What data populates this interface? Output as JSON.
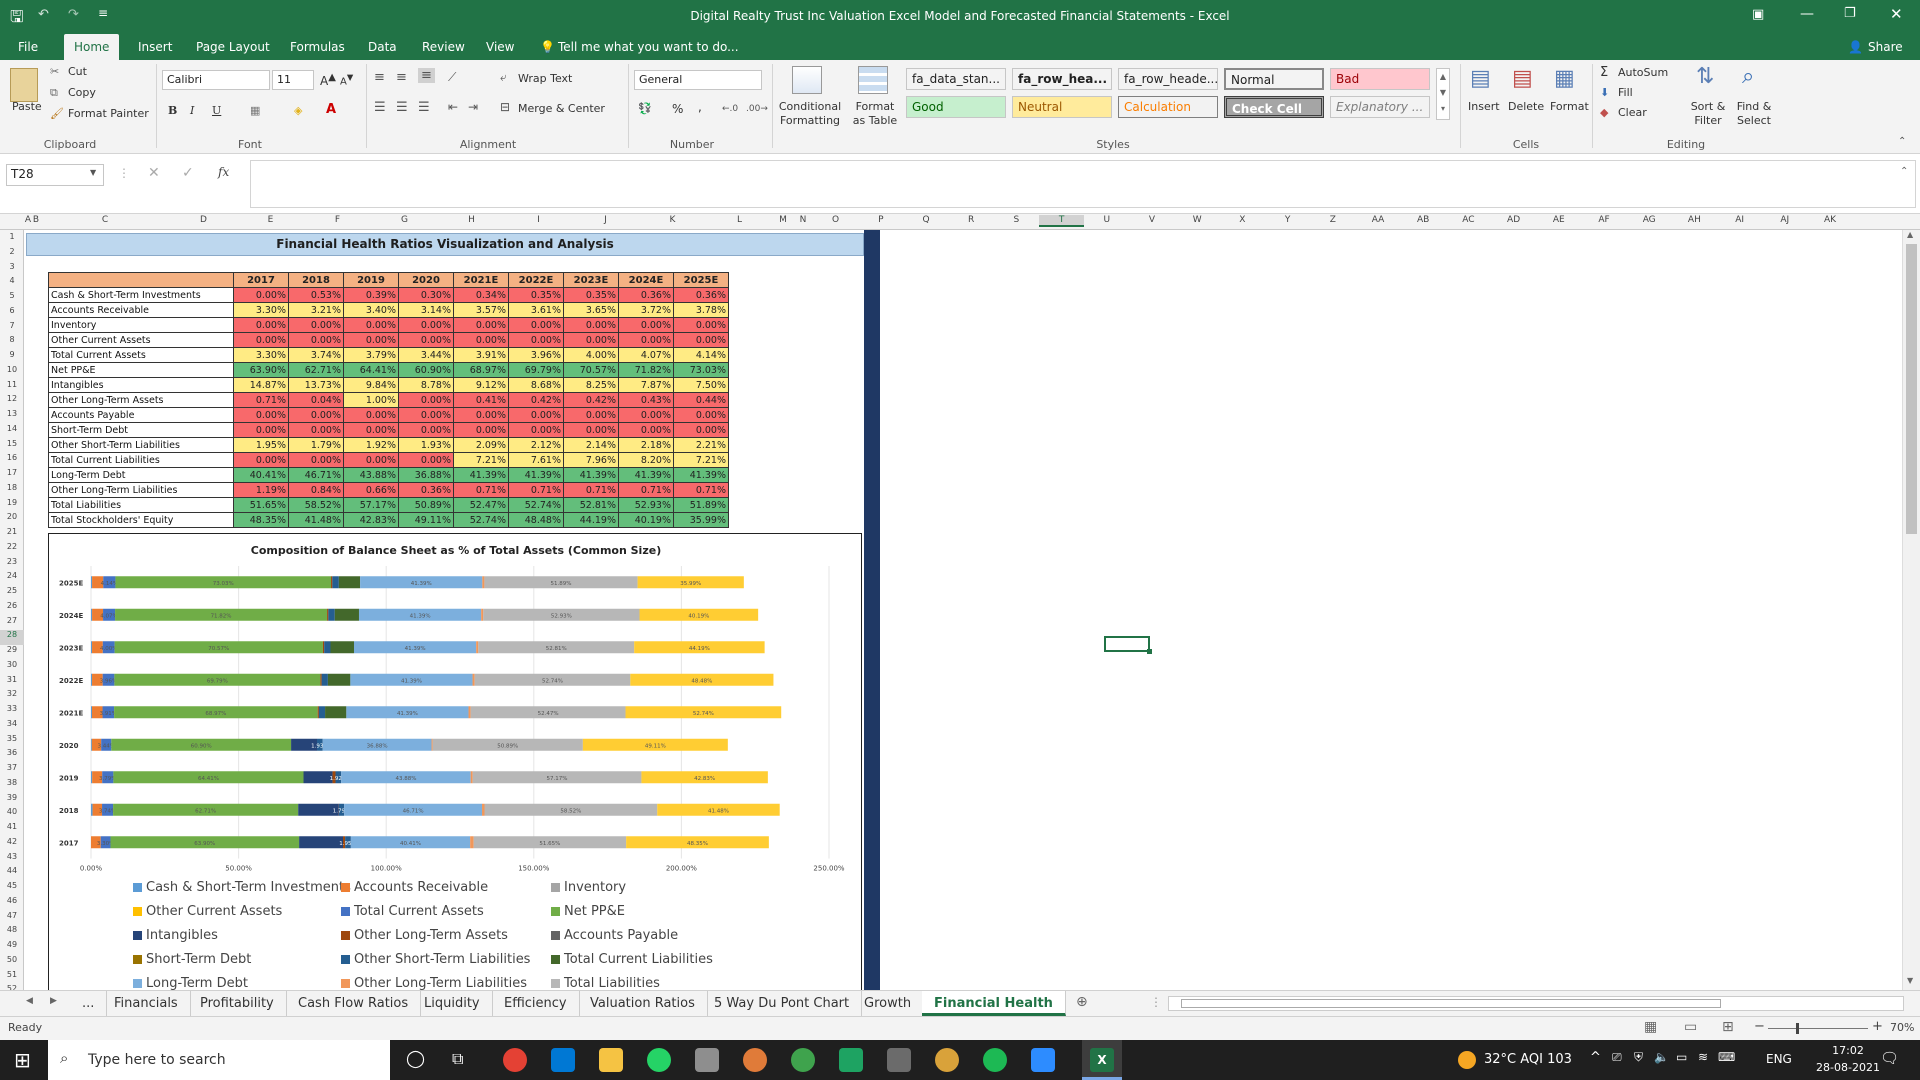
{
  "window": {
    "title": "Digital Realty Trust Inc Valuation Excel Model and Forecasted Financial Statements  -  Excel",
    "share": "Share"
  },
  "ribbon_tabs": [
    "File",
    "Home",
    "Insert",
    "Page Layout",
    "Formulas",
    "Data",
    "Review",
    "View"
  ],
  "tell_me": "Tell me what you want to do...",
  "ribbon": {
    "clipboard": {
      "paste": "Paste",
      "cut": "Cut",
      "copy": "Copy",
      "format_painter": "Format Painter",
      "label": "Clipboard"
    },
    "font": {
      "name": "Calibri",
      "size": "11",
      "label": "Font",
      "bold": "B",
      "italic": "I",
      "underline": "U"
    },
    "alignment": {
      "wrap": "Wrap Text",
      "merge": "Merge & Center",
      "label": "Alignment"
    },
    "number": {
      "format": "General",
      "label": "Number",
      "percent": "%",
      "comma": ","
    },
    "styles": {
      "conditional": "Conditional Formatting",
      "format_table": "Format as Table",
      "label": "Styles",
      "cells": [
        {
          "text": "fa_data_stan...",
          "bg": "#ffffff",
          "fg": "#000000"
        },
        {
          "text": "fa_row_hea...",
          "bg": "#ffffff",
          "fg": "#000000"
        },
        {
          "text": "fa_row_heade...",
          "bg": "#ffffff",
          "fg": "#444444"
        },
        {
          "text": "Normal",
          "bg": "#ffffff",
          "fg": "#000000"
        },
        {
          "text": "Bad",
          "bg": "#ffc7ce",
          "fg": "#9c0006"
        },
        {
          "text": "Good",
          "bg": "#c6efce",
          "fg": "#006100"
        },
        {
          "text": "Neutral",
          "bg": "#ffeb9c",
          "fg": "#9c5700"
        },
        {
          "text": "Calculation",
          "bg": "#f2f2f2",
          "fg": "#fa7d00"
        },
        {
          "text": "Check Cell",
          "bg": "#a5a5a5",
          "fg": "#ffffff"
        },
        {
          "text": "Explanatory ...",
          "bg": "#ffffff",
          "fg": "#7f7f7f"
        }
      ]
    },
    "cells": {
      "insert": "Insert",
      "delete": "Delete",
      "format": "Format",
      "label": "Cells"
    },
    "editing": {
      "autosum": "AutoSum",
      "fill": "Fill",
      "clear": "Clear",
      "sort": "Sort & Filter",
      "find": "Find & Select",
      "label": "Editing"
    }
  },
  "formula_bar": {
    "name_box": "T28",
    "fx": "fx",
    "value": ""
  },
  "columns": [
    "A",
    "B",
    "C",
    "D",
    "E",
    "F",
    "G",
    "H",
    "I",
    "J",
    "K",
    "L",
    "M",
    "N",
    "O",
    "P",
    "Q",
    "R",
    "S",
    "T",
    "U",
    "V",
    "W",
    "X",
    "Y",
    "Z",
    "AA",
    "AB",
    "AC",
    "AD",
    "AE",
    "AF",
    "AG",
    "AH",
    "AI",
    "AJ",
    "AK"
  ],
  "rows": [
    "1",
    "2",
    "3",
    "4",
    "5",
    "6",
    "7",
    "8",
    "9",
    "10",
    "11",
    "12",
    "13",
    "14",
    "15",
    "16",
    "17",
    "18",
    "19",
    "20",
    "21",
    "22",
    "23",
    "24",
    "25",
    "26",
    "27",
    "28",
    "29",
    "30",
    "31",
    "32",
    "33",
    "34",
    "35",
    "36",
    "37",
    "38",
    "39",
    "40",
    "41",
    "42",
    "43",
    "44",
    "45",
    "46",
    "47",
    "48",
    "49",
    "50",
    "51",
    "52"
  ],
  "sheet": {
    "title": "Financial Health Ratios Visualization and Analysis",
    "years": [
      "2017",
      "2018",
      "2019",
      "2020",
      "2021E",
      "2022E",
      "2023E",
      "2024E",
      "2025E"
    ],
    "table": [
      {
        "label": "Cash & Short-Term Investments",
        "values": [
          "0.00%",
          "0.53%",
          "0.39%",
          "0.30%",
          "0.34%",
          "0.35%",
          "0.35%",
          "0.36%",
          "0.36%"
        ],
        "colors": [
          "#f8696b",
          "#f8696b",
          "#f8696b",
          "#f8696b",
          "#f8696b",
          "#f8696b",
          "#f8696b",
          "#f8696b",
          "#f8696b"
        ]
      },
      {
        "label": "Accounts Receivable",
        "values": [
          "3.30%",
          "3.21%",
          "3.40%",
          "3.14%",
          "3.57%",
          "3.61%",
          "3.65%",
          "3.72%",
          "3.78%"
        ],
        "colors": [
          "#ffeb84",
          "#ffeb84",
          "#ffeb84",
          "#ffeb84",
          "#ffeb84",
          "#ffeb84",
          "#ffeb84",
          "#ffeb84",
          "#ffeb84"
        ]
      },
      {
        "label": "Inventory",
        "values": [
          "0.00%",
          "0.00%",
          "0.00%",
          "0.00%",
          "0.00%",
          "0.00%",
          "0.00%",
          "0.00%",
          "0.00%"
        ],
        "colors": [
          "#f8696b",
          "#f8696b",
          "#f8696b",
          "#f8696b",
          "#f8696b",
          "#f8696b",
          "#f8696b",
          "#f8696b",
          "#f8696b"
        ]
      },
      {
        "label": "Other Current Assets",
        "values": [
          "0.00%",
          "0.00%",
          "0.00%",
          "0.00%",
          "0.00%",
          "0.00%",
          "0.00%",
          "0.00%",
          "0.00%"
        ],
        "colors": [
          "#f8696b",
          "#f8696b",
          "#f8696b",
          "#f8696b",
          "#f8696b",
          "#f8696b",
          "#f8696b",
          "#f8696b",
          "#f8696b"
        ]
      },
      {
        "label": "Total Current Assets",
        "values": [
          "3.30%",
          "3.74%",
          "3.79%",
          "3.44%",
          "3.91%",
          "3.96%",
          "4.00%",
          "4.07%",
          "4.14%"
        ],
        "colors": [
          "#ffeb84",
          "#ffeb84",
          "#ffeb84",
          "#ffeb84",
          "#ffeb84",
          "#ffeb84",
          "#ffeb84",
          "#ffeb84",
          "#ffeb84"
        ]
      },
      {
        "label": "Net PP&E",
        "values": [
          "63.90%",
          "62.71%",
          "64.41%",
          "60.90%",
          "68.97%",
          "69.79%",
          "70.57%",
          "71.82%",
          "73.03%"
        ],
        "colors": [
          "#63be7b",
          "#63be7b",
          "#63be7b",
          "#63be7b",
          "#63be7b",
          "#63be7b",
          "#63be7b",
          "#63be7b",
          "#63be7b"
        ]
      },
      {
        "label": "Intangibles",
        "values": [
          "14.87%",
          "13.73%",
          "9.84%",
          "8.78%",
          "9.12%",
          "8.68%",
          "8.25%",
          "7.87%",
          "7.50%"
        ],
        "colors": [
          "#ffeb84",
          "#ffeb84",
          "#ffeb84",
          "#ffeb84",
          "#ffeb84",
          "#ffeb84",
          "#ffeb84",
          "#ffeb84",
          "#ffeb84"
        ]
      },
      {
        "label": "Other Long-Term Assets",
        "values": [
          "0.71%",
          "0.04%",
          "1.00%",
          "0.00%",
          "0.41%",
          "0.42%",
          "0.42%",
          "0.43%",
          "0.44%"
        ],
        "colors": [
          "#f8696b",
          "#f8696b",
          "#ffeb84",
          "#f8696b",
          "#f8696b",
          "#f8696b",
          "#f8696b",
          "#f8696b",
          "#f8696b"
        ]
      },
      {
        "label": "Accounts Payable",
        "values": [
          "0.00%",
          "0.00%",
          "0.00%",
          "0.00%",
          "0.00%",
          "0.00%",
          "0.00%",
          "0.00%",
          "0.00%"
        ],
        "colors": [
          "#f8696b",
          "#f8696b",
          "#f8696b",
          "#f8696b",
          "#f8696b",
          "#f8696b",
          "#f8696b",
          "#f8696b",
          "#f8696b"
        ]
      },
      {
        "label": "Short-Term Debt",
        "values": [
          "0.00%",
          "0.00%",
          "0.00%",
          "0.00%",
          "0.00%",
          "0.00%",
          "0.00%",
          "0.00%",
          "0.00%"
        ],
        "colors": [
          "#f8696b",
          "#f8696b",
          "#f8696b",
          "#f8696b",
          "#f8696b",
          "#f8696b",
          "#f8696b",
          "#f8696b",
          "#f8696b"
        ]
      },
      {
        "label": "Other Short-Term Liabilities",
        "values": [
          "1.95%",
          "1.79%",
          "1.92%",
          "1.93%",
          "2.09%",
          "2.12%",
          "2.14%",
          "2.18%",
          "2.21%"
        ],
        "colors": [
          "#ffeb84",
          "#ffeb84",
          "#ffeb84",
          "#ffeb84",
          "#ffeb84",
          "#ffeb84",
          "#ffeb84",
          "#ffeb84",
          "#ffeb84"
        ]
      },
      {
        "label": "Total Current Liabilities",
        "values": [
          "0.00%",
          "0.00%",
          "0.00%",
          "0.00%",
          "7.21%",
          "7.61%",
          "7.96%",
          "8.20%",
          "7.21%"
        ],
        "colors": [
          "#f8696b",
          "#f8696b",
          "#f8696b",
          "#f8696b",
          "#ffeb84",
          "#ffeb84",
          "#ffeb84",
          "#ffeb84",
          "#ffeb84"
        ]
      },
      {
        "label": "Long-Term Debt",
        "values": [
          "40.41%",
          "46.71%",
          "43.88%",
          "36.88%",
          "41.39%",
          "41.39%",
          "41.39%",
          "41.39%",
          "41.39%"
        ],
        "colors": [
          "#63be7b",
          "#63be7b",
          "#63be7b",
          "#63be7b",
          "#63be7b",
          "#63be7b",
          "#63be7b",
          "#63be7b",
          "#63be7b"
        ]
      },
      {
        "label": "Other Long-Term Liabilities",
        "values": [
          "1.19%",
          "0.84%",
          "0.66%",
          "0.36%",
          "0.71%",
          "0.71%",
          "0.71%",
          "0.71%",
          "0.71%"
        ],
        "colors": [
          "#f8696b",
          "#f8696b",
          "#f8696b",
          "#f8696b",
          "#f8696b",
          "#f8696b",
          "#f8696b",
          "#f8696b",
          "#f8696b"
        ]
      },
      {
        "label": "Total Liabilities",
        "values": [
          "51.65%",
          "58.52%",
          "57.17%",
          "50.89%",
          "52.47%",
          "52.74%",
          "52.81%",
          "52.93%",
          "51.89%"
        ],
        "colors": [
          "#63be7b",
          "#63be7b",
          "#63be7b",
          "#63be7b",
          "#63be7b",
          "#63be7b",
          "#63be7b",
          "#63be7b",
          "#63be7b"
        ]
      },
      {
        "label": "Total Stockholders' Equity",
        "values": [
          "48.35%",
          "41.48%",
          "42.83%",
          "49.11%",
          "52.74%",
          "48.48%",
          "44.19%",
          "40.19%",
          "35.99%"
        ],
        "colors": [
          "#63be7b",
          "#63be7b",
          "#63be7b",
          "#63be7b",
          "#63be7b",
          "#63be7b",
          "#63be7b",
          "#63be7b",
          "#63be7b"
        ]
      }
    ]
  },
  "chart_data": {
    "type": "bar",
    "orientation": "horizontal-stacked",
    "title": "Composition of Balance Sheet as % of Total Assets (Common Size)",
    "categories": [
      "2025E",
      "2024E",
      "2023E",
      "2022E",
      "2021E",
      "2020",
      "2019",
      "2018",
      "2017"
    ],
    "xlim": [
      0,
      250
    ],
    "xticks": [
      "0.00%",
      "50.00%",
      "100.00%",
      "150.00%",
      "200.00%",
      "250.00%"
    ],
    "series": [
      {
        "name": "Cash & Short-Term Investments",
        "color": "#5b9bd5",
        "values": [
          0.36,
          0.36,
          0.35,
          0.35,
          0.34,
          0.3,
          0.39,
          0.53,
          0.0
        ]
      },
      {
        "name": "Accounts Receivable",
        "color": "#ed7d31",
        "values": [
          3.78,
          3.72,
          3.65,
          3.61,
          3.57,
          3.14,
          3.4,
          3.21,
          3.3
        ]
      },
      {
        "name": "Inventory",
        "color": "#a5a5a5",
        "values": [
          0,
          0,
          0,
          0,
          0,
          0,
          0,
          0,
          0
        ]
      },
      {
        "name": "Other Current Assets",
        "color": "#ffc000",
        "values": [
          0,
          0,
          0,
          0,
          0,
          0,
          0,
          0,
          0
        ]
      },
      {
        "name": "Total Current Assets",
        "color": "#4472c4",
        "values": [
          4.14,
          4.07,
          4.0,
          3.96,
          3.91,
          3.44,
          3.79,
          3.74,
          3.3
        ]
      },
      {
        "name": "Net PP&E",
        "color": "#70ad47",
        "values": [
          73.03,
          71.82,
          70.57,
          69.79,
          68.97,
          60.9,
          64.41,
          62.71,
          63.9
        ]
      },
      {
        "name": "Intangibles",
        "color": "#264478",
        "values": [
          0,
          0,
          0,
          0,
          0,
          8.78,
          9.84,
          13.73,
          14.87
        ]
      },
      {
        "name": "Other Long-Term Assets",
        "color": "#9e480e",
        "values": [
          0.44,
          0.43,
          0.42,
          0.42,
          0.41,
          0.0,
          1.0,
          0.04,
          0.71
        ]
      },
      {
        "name": "Accounts Payable",
        "color": "#636363",
        "values": [
          0,
          0,
          0,
          0,
          0,
          0,
          0,
          0,
          0
        ]
      },
      {
        "name": "Short-Term Debt",
        "color": "#997300",
        "values": [
          0,
          0,
          0,
          0,
          0,
          0,
          0,
          0,
          0
        ]
      },
      {
        "name": "Other Short-Term Liabilities",
        "color": "#255e91",
        "values": [
          2.21,
          2.18,
          2.14,
          2.12,
          2.09,
          1.93,
          1.92,
          1.79,
          1.95
        ]
      },
      {
        "name": "Total Current Liabilities",
        "color": "#43682b",
        "values": [
          7.21,
          8.2,
          7.96,
          7.61,
          7.21,
          0,
          0,
          0,
          0
        ]
      },
      {
        "name": "Long-Term Debt",
        "color": "#7cafdd",
        "values": [
          41.39,
          41.39,
          41.39,
          41.39,
          41.39,
          36.88,
          43.88,
          46.71,
          40.41
        ]
      },
      {
        "name": "Other Long-Term Liabilities",
        "color": "#f1975a",
        "values": [
          0.71,
          0.71,
          0.71,
          0.71,
          0.71,
          0.36,
          0.66,
          0.84,
          1.19
        ]
      },
      {
        "name": "Total Liabilities",
        "color": "#b7b7b7",
        "values": [
          51.89,
          52.93,
          52.81,
          52.74,
          52.47,
          50.89,
          57.17,
          58.52,
          51.65
        ]
      },
      {
        "name": "Total Stockholders' Equity",
        "color": "#ffcd33",
        "values": [
          35.99,
          40.19,
          44.19,
          48.48,
          52.74,
          49.11,
          42.83,
          41.48,
          48.35
        ]
      }
    ],
    "bar_labels": [
      {
        "series": "Total Current Assets",
        "texts": [
          "4.14%",
          "4.07%",
          "4.00%",
          "3.96%",
          "3.91%",
          "3.44%",
          "3.79%",
          "3.74%",
          "3.30%"
        ]
      },
      {
        "series": "Net PP&E",
        "texts": [
          "73.03%",
          "71.82%",
          "70.57%",
          "69.79%",
          "68.97%",
          "60.90%",
          "64.41%",
          "62.71%",
          "63.90%"
        ]
      },
      {
        "series": "Other Short-Term Liabilities",
        "texts": [
          "",
          "",
          "",
          "",
          "",
          "1.93%",
          "1.92%",
          "1.79%",
          "1.95%"
        ]
      },
      {
        "series": "Long-Term Debt",
        "texts": [
          "41.39%",
          "41.39%",
          "41.39%",
          "41.39%",
          "41.39%",
          "36.88%",
          "43.88%",
          "46.71%",
          "40.41%"
        ]
      },
      {
        "series": "Total Liabilities",
        "texts": [
          "51.89%",
          "52.93%",
          "52.81%",
          "52.74%",
          "52.47%",
          "50.89%",
          "57.17%",
          "58.52%",
          "51.65%"
        ]
      },
      {
        "series": "Total Stockholders' Equity",
        "texts": [
          "35.99%",
          "40.19%",
          "44.19%",
          "48.48%",
          "52.74%",
          "49.11%",
          "42.83%",
          "41.48%",
          "48.35%"
        ]
      }
    ],
    "legend_visible": [
      "Cash & Short-Term Investments",
      "Accounts Receivable",
      "Inventory",
      "Other Current Assets",
      "Total Current Assets",
      "Net PP&E",
      "Intangibles",
      "Other Long-Term Assets",
      "Accounts Payable",
      "Short-Term Debt",
      "Other Short-Term Liabilities",
      "Total Current Liabilities",
      "Long-Term Debt",
      "Other Long-Term Liabilities",
      "Total Liabilities"
    ],
    "legend_position": "bottom"
  },
  "sheet_tabs": [
    "...",
    "Financials",
    "Profitability",
    "Cash Flow Ratios",
    "Liquidity",
    "Efficiency",
    "Valuation Ratios",
    "5 Way Du Pont Chart",
    "Growth",
    "Financial Health"
  ],
  "active_sheet": "Financial Health",
  "status": {
    "ready": "Ready",
    "zoom": "70%"
  },
  "taskbar": {
    "search": "Type here to search",
    "weather": "32°C  AQI 103",
    "lang": "ENG",
    "time": "17:02",
    "date": "28-08-2021"
  }
}
